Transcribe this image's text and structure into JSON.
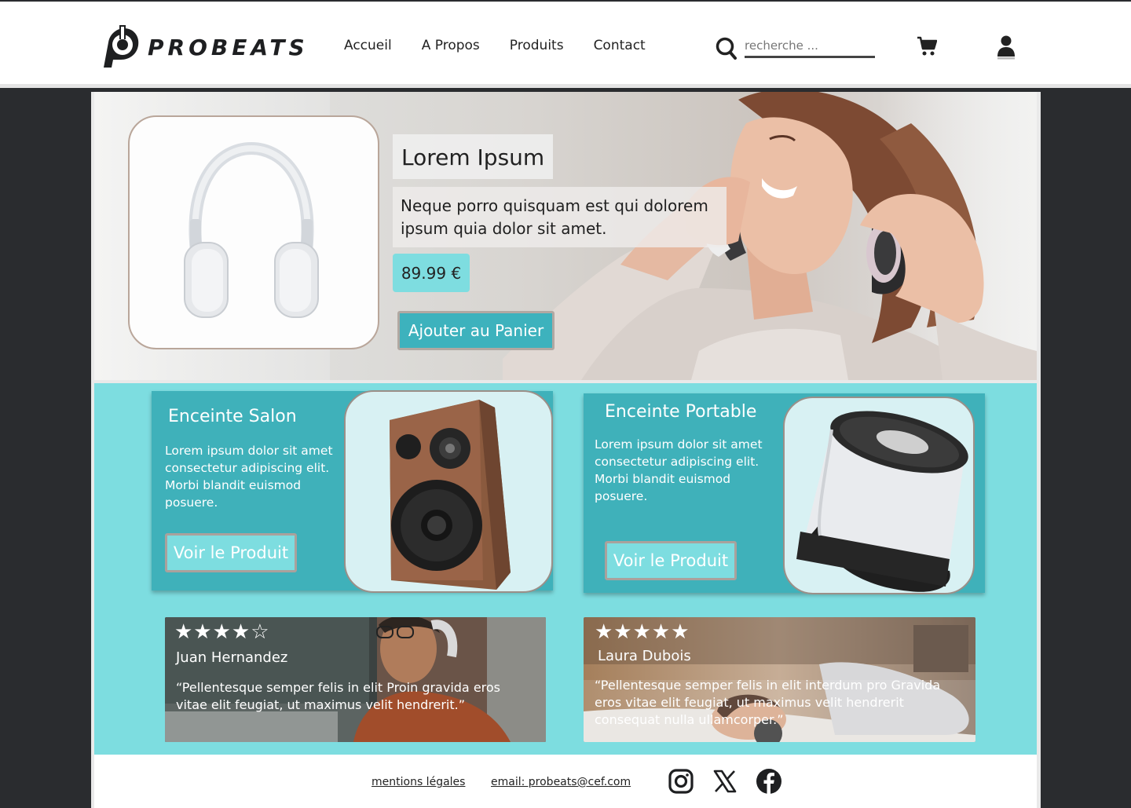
{
  "header": {
    "brand": "PROBEATS",
    "nav": [
      "Accueil",
      "A Propos",
      "Produits",
      "Contact"
    ],
    "search_placeholder": "recherche ...",
    "icons": {
      "search": "search-icon",
      "cart": "cart-icon",
      "user": "user-icon"
    }
  },
  "hero": {
    "title": "Lorem Ipsum",
    "description": "Neque porro quisquam est qui dolorem ipsum quia dolor sit amet.",
    "price": "89.99 €",
    "cta": "Ajouter au Panier"
  },
  "products": [
    {
      "name": "Enceinte Salon",
      "description": "Lorem ipsum dolor sit amet consectetur adipiscing elit. Morbi blandit euismod posuere.",
      "button": "Voir le Produit"
    },
    {
      "name": "Enceinte Portable",
      "description": "Lorem ipsum dolor sit amet consectetur adipiscing elit. Morbi blandit euismod posuere.",
      "button": "Voir le Produit"
    }
  ],
  "reviews": [
    {
      "stars": "★★★★☆",
      "rating": 4,
      "name": "Juan Hernandez",
      "quote": "“Pellentesque semper felis in elit Proin gravida eros vitae elit feugiat, ut maximus velit hendrerit.”"
    },
    {
      "stars": "★★★★★",
      "rating": 5,
      "name": "Laura Dubois",
      "quote": "“Pellentesque semper felis in elit interdum pro Gravida eros vitae elit feugiat, ut maximus velit hendrerit  consequat nulla  ullamcorper.”"
    }
  ],
  "footer": {
    "legal": "mentions légales",
    "email": "email: probeats@cef.com",
    "social": [
      "instagram-icon",
      "x-icon",
      "facebook-icon"
    ]
  },
  "colors": {
    "accent": "#3db2bd",
    "accent_light": "#7ddde0",
    "dark": "#2a2c2f"
  }
}
